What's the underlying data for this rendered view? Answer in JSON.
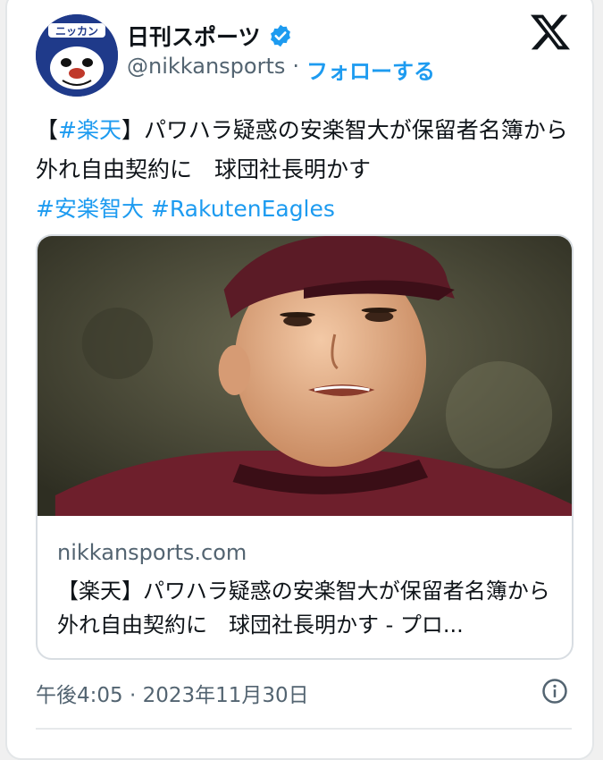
{
  "account": {
    "name": "日刊スポーツ",
    "handle": "@nikkansports",
    "separator": "·",
    "follow_label": "フォローする",
    "avatar_logo_text": "ニッカン"
  },
  "tweet": {
    "prefix_bracket_open": "【",
    "hashtag_team": "#楽天",
    "body": "】パワハラ疑惑の安楽智大が保留者名簿から外れ自由契約に　球団社長明かす",
    "hashtags": [
      "#安楽智大",
      "#RakutenEagles"
    ]
  },
  "link_card": {
    "domain": "nikkansports.com",
    "title": "【楽天】パワハラ疑惑の安楽智大が保留者名簿から外れ自由契約に　球団社長明かす - プロ..."
  },
  "timestamp": "午後4:05 · 2023年11月30日",
  "icons": [
    "verified-icon",
    "x-logo-icon",
    "info-icon"
  ],
  "colors": {
    "accent": "#1d9bf0",
    "muted": "#536471",
    "text": "#0f1419"
  }
}
